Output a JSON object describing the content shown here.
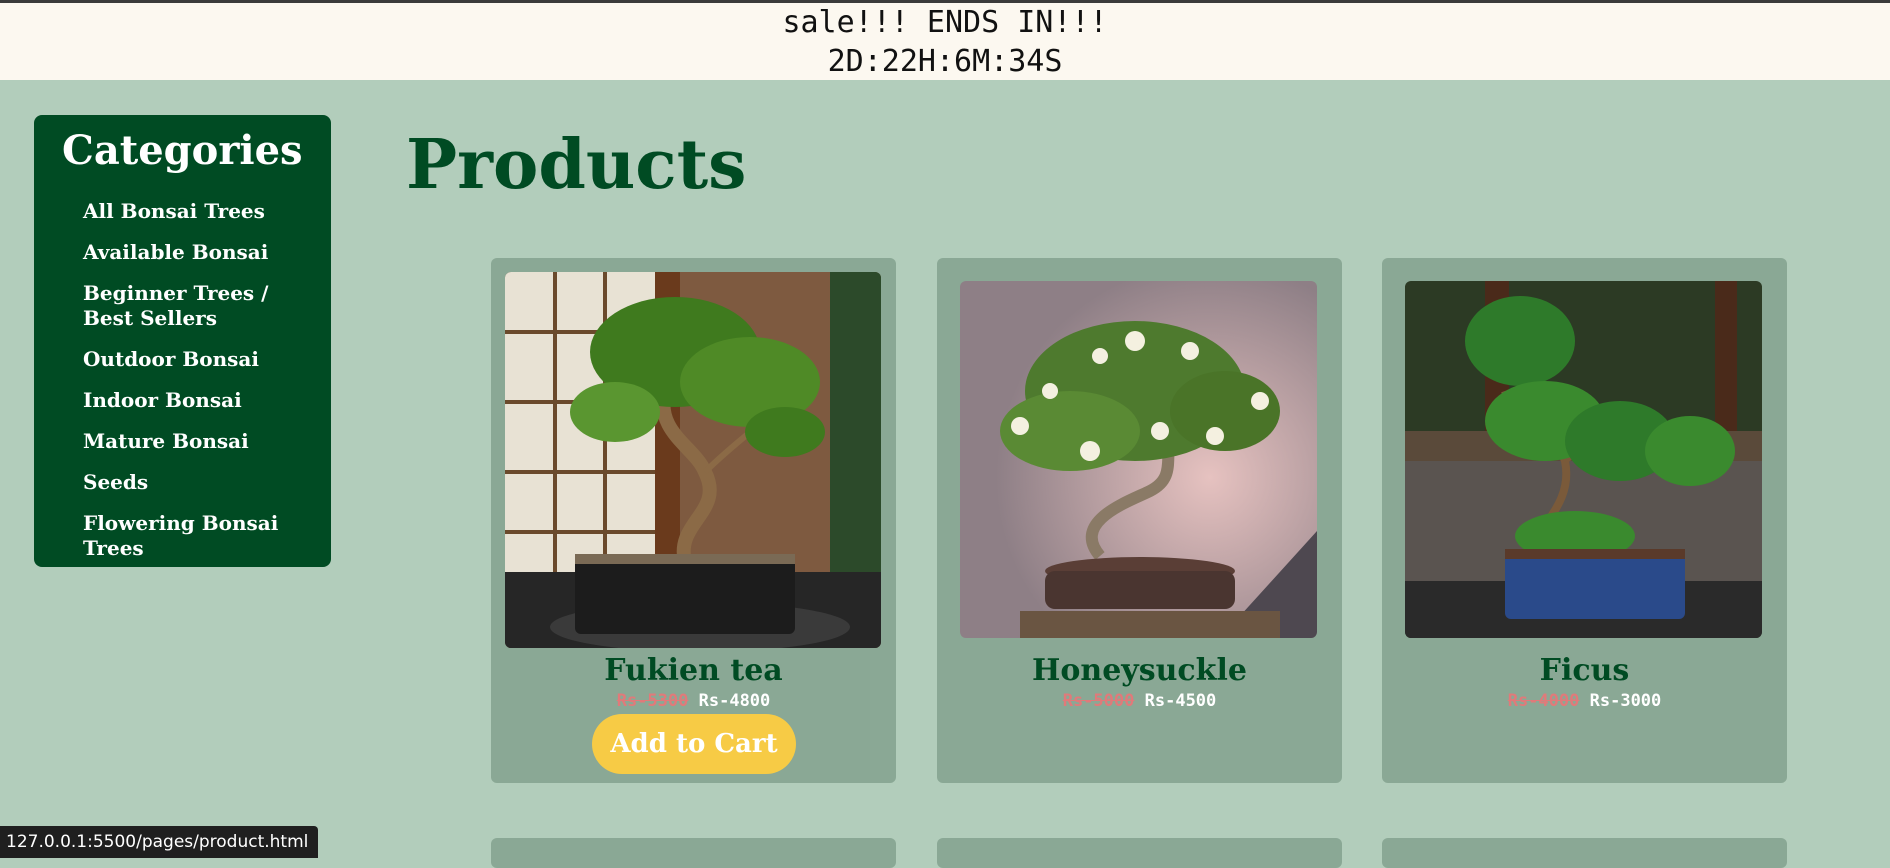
{
  "banner": {
    "line1": "sale!!! ENDS IN!!!",
    "line2": "2D:22H:6M:34S"
  },
  "sidebar": {
    "title": "Categories",
    "items": [
      {
        "label": "All Bonsai Trees"
      },
      {
        "label": "Available Bonsai"
      },
      {
        "label": "Beginner Trees / Best Sellers"
      },
      {
        "label": "Outdoor Bonsai"
      },
      {
        "label": "Indoor Bonsai"
      },
      {
        "label": "Mature Bonsai"
      },
      {
        "label": "Seeds"
      },
      {
        "label": "Flowering Bonsai Trees"
      }
    ]
  },
  "main": {
    "title": "Products",
    "products": [
      {
        "name": "Fukien tea",
        "old_price": "Rs-5300",
        "new_price": "Rs-4800",
        "cta": "Add to Cart"
      },
      {
        "name": "Honeysuckle",
        "old_price": "Rs-5000",
        "new_price": "Rs-4500"
      },
      {
        "name": "Ficus",
        "old_price": "Rs-4000",
        "new_price": "Rs-3000"
      }
    ]
  },
  "status_bar": {
    "url": "127.0.0.1:5500/pages/product.html"
  },
  "colors": {
    "background": "#b2cdbb",
    "sidebar": "#004b23",
    "card": "#8aa895",
    "button": "#f7cb45",
    "old_price": "#e07a7a"
  }
}
